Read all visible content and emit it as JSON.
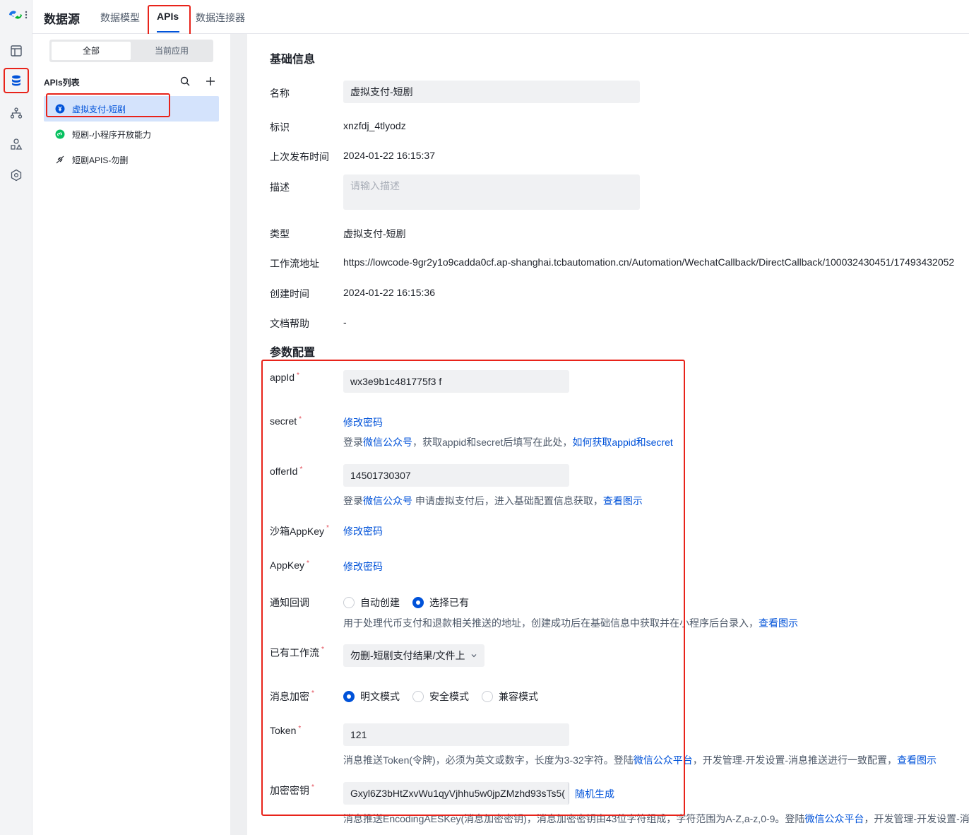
{
  "header": {
    "brand": "数据源",
    "tabs": [
      "数据模型",
      "APIs",
      "数据连接器"
    ],
    "active_tab": "APIs"
  },
  "rail": {
    "items": [
      "layout-icon",
      "database-icon",
      "flow-icon",
      "shapes-icon",
      "settings-hex-icon"
    ]
  },
  "side": {
    "segment": {
      "all": "全部",
      "current": "当前应用"
    },
    "list_title": "APIs列表",
    "items": [
      {
        "label": "虚拟支付-短剧",
        "icon": "yen-coin-icon"
      },
      {
        "label": "短剧-小程序开放能力",
        "icon": "mini-program-icon"
      },
      {
        "label": "短剧APIS-勿删",
        "icon": "plug-icon"
      }
    ]
  },
  "basic": {
    "title": "基础信息",
    "name_label": "名称",
    "name_value": "虚拟支付-短剧",
    "id_label": "标识",
    "id_value": "xnzfdj_4tlyodz",
    "published_label": "上次发布时间",
    "published_value": "2024-01-22 16:15:37",
    "desc_label": "描述",
    "desc_placeholder": "请输入描述",
    "type_label": "类型",
    "type_value": "虚拟支付-短剧",
    "workflow_label": "工作流地址",
    "workflow_value": "https://lowcode-9gr2y1o9cadda0cf.ap-shanghai.tcbautomation.cn/Automation/WechatCallback/DirectCallback/100032430451/17493432052",
    "created_label": "创建时间",
    "created_value": "2024-01-22 16:15:36",
    "doc_label": "文档帮助",
    "doc_value": "-"
  },
  "params": {
    "title": "参数配置",
    "appid_label": "appId",
    "appid_value": "wx3e9b1c481775f3 f",
    "secret_label": "secret",
    "secret_link": "修改密码",
    "secret_help_a": "登录",
    "secret_help_link1": "微信公众号",
    "secret_help_b": "，获取appid和secret后填写在此处，",
    "secret_help_link2": "如何获取appid和secret",
    "offerid_label": "offerId",
    "offerid_value": "14501730307",
    "offerid_help_a": "登录",
    "offerid_help_link1": "微信公众号",
    "offerid_help_b": " 申请虚拟支付后，进入基础配置信息获取，",
    "offerid_help_link2": "查看图示",
    "sandbox_label": "沙箱AppKey",
    "sandbox_link": "修改密码",
    "appkey_label": "AppKey",
    "appkey_link": "修改密码",
    "notify_label": "通知回调",
    "notify_opt1": "自动创建",
    "notify_opt2": "选择已有",
    "notify_help": "用于处理代币支付和退款相关推送的地址，创建成功后在基础信息中获取并在小程序后台录入，",
    "notify_help_link": "查看图示",
    "workflow_label": "已有工作流",
    "workflow_value": "勿删-短剧支付结果/文件上",
    "encrypt_label": "消息加密",
    "encrypt_opt1": "明文模式",
    "encrypt_opt2": "安全模式",
    "encrypt_opt3": "兼容模式",
    "token_label": "Token",
    "token_value": "121",
    "token_help_a": "消息推送Token(令牌)，必须为英文或数字，长度为3-32字符。登陆",
    "token_help_link1": "微信公众平台",
    "token_help_b": "，开发管理-开发设置-消息推送进行一致配置，",
    "token_help_link2": "查看图示",
    "aeskey_label": "加密密钥",
    "aeskey_value": "Gxyl6Z3bHtZxvWu1qyVjhhu5w0jpZMzhd93sTs5(",
    "aeskey_random": "随机生成",
    "aeskey_help_a": "消息推送EncodingAESKey(消息加密密钥)，消息加密密钥由43位字符组成，字符范围为A-Z,a-z,0-9。登陆",
    "aeskey_help_link1": "微信公众平台",
    "aeskey_help_b": "，开发管理-开发设置-消"
  }
}
